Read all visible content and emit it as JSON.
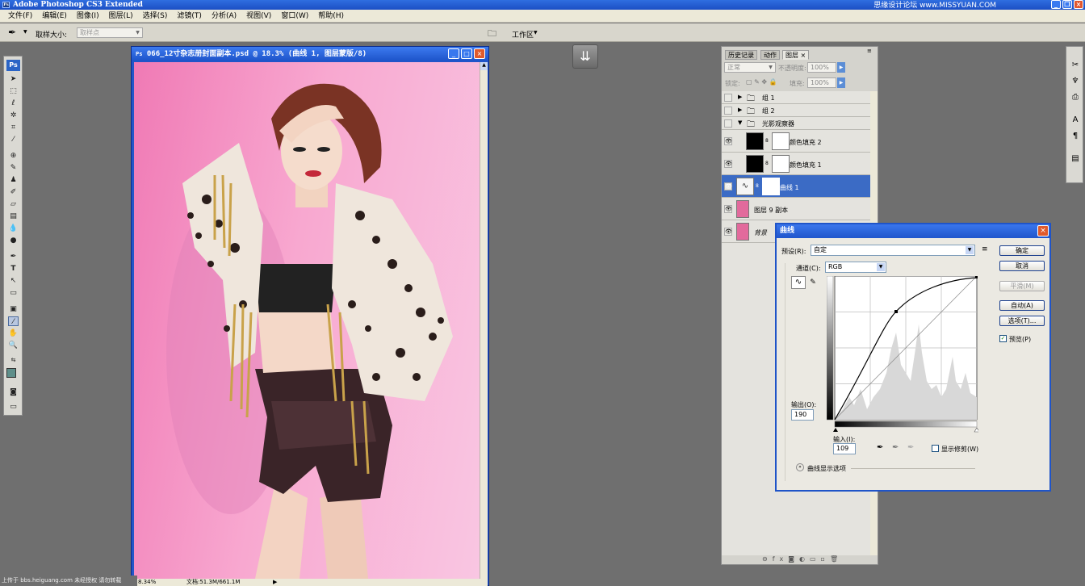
{
  "app": {
    "title": "Adobe Photoshop CS3 Extended",
    "watermark": "思缘设计论坛  www.MISSYUAN.COM"
  },
  "menu": [
    "文件(F)",
    "编辑(E)",
    "图像(I)",
    "图层(L)",
    "选择(S)",
    "滤镜(T)",
    "分析(A)",
    "视图(V)",
    "窗口(W)",
    "帮助(H)"
  ],
  "options": {
    "sample_size_label": "取样大小:",
    "sample_size_value": "取样点",
    "workspace_label": "工作区"
  },
  "document": {
    "title": "066_12寸杂志册封面副本.psd @ 18.3% (曲线 1, 图层蒙版/8)",
    "zoom": "8.34%",
    "doc_size": "文档:51.3M/661.1M"
  },
  "layers_panel": {
    "tabs": [
      "历史记录",
      "动作",
      "图层"
    ],
    "blend_mode": "正常",
    "opacity_label": "不透明度:",
    "opacity_value": "100%",
    "lock_label": "锁定:",
    "fill_label": "填充:",
    "fill_value": "100%",
    "layers": [
      {
        "name": "组 1",
        "type": "group"
      },
      {
        "name": "组 2",
        "type": "group"
      },
      {
        "name": "光影观察器",
        "type": "group-open"
      },
      {
        "name": "颜色填充 2",
        "type": "fill"
      },
      {
        "name": "颜色填充 1",
        "type": "fill"
      },
      {
        "name": "曲线 1",
        "type": "curves",
        "selected": true
      },
      {
        "name": "图层 9 副本",
        "type": "image"
      },
      {
        "name": "背景",
        "type": "image"
      }
    ]
  },
  "curves_dialog": {
    "title": "曲线",
    "preset_label": "预设(R):",
    "preset_value": "自定",
    "channel_label": "通道(C):",
    "channel_value": "RGB",
    "output_label": "输出(O):",
    "output_value": "190",
    "input_label": "输入(I):",
    "input_value": "109",
    "show_clipping": "显示修剪(W)",
    "display_options": "曲线显示选项",
    "buttons": {
      "ok": "确定",
      "cancel": "取消",
      "smooth": "平滑(M)",
      "auto": "自动(A)",
      "options": "选项(T)..."
    },
    "preview": "预览(P)"
  },
  "footer": "上传于 bbs.heiguang.com  未经授权  请勿转载"
}
